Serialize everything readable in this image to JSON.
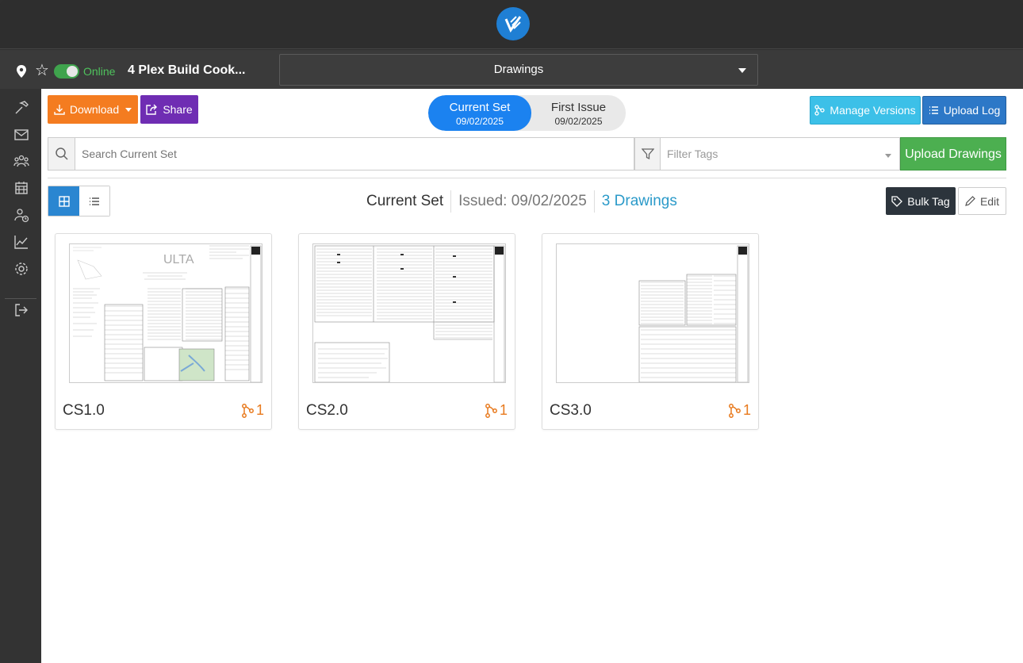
{
  "header": {
    "logo_icon": "app-logo-icon",
    "status_label": "Online",
    "project_name": "4 Plex Build Cook...",
    "section_selected": "Drawings"
  },
  "sidebar": {
    "items": [
      {
        "icon": "hammer-icon"
      },
      {
        "icon": "mail-icon"
      },
      {
        "icon": "team-icon"
      },
      {
        "icon": "calendar-icon"
      },
      {
        "icon": "user-clock-icon"
      },
      {
        "icon": "chart-icon"
      },
      {
        "icon": "gear-icon"
      },
      {
        "icon": "logout-icon"
      }
    ]
  },
  "toolbar": {
    "download_label": "Download",
    "share_label": "Share",
    "manage_versions_label": "Manage Versions",
    "upload_log_label": "Upload Log"
  },
  "sets": [
    {
      "name": "Current Set",
      "date": "09/02/2025",
      "active": true
    },
    {
      "name": "First Issue",
      "date": "09/02/2025",
      "active": false
    }
  ],
  "search": {
    "placeholder": "Search Current Set",
    "filter_placeholder": "Filter Tags",
    "upload_label": "Upload Drawings"
  },
  "set_info": {
    "name": "Current Set",
    "issued": "Issued: 09/02/2025",
    "count": "3 Drawings",
    "bulk_tag_label": "Bulk Tag",
    "edit_label": "Edit"
  },
  "drawings": [
    {
      "name": "CS1.0",
      "versions": "1"
    },
    {
      "name": "CS2.0",
      "versions": "1"
    },
    {
      "name": "CS3.0",
      "versions": "1"
    }
  ],
  "colors": {
    "accent_blue": "#1b82f0",
    "download_orange": "#f47c20",
    "share_purple": "#6f2db3",
    "upload_green": "#4caf50",
    "version_orange": "#e87a1e"
  }
}
